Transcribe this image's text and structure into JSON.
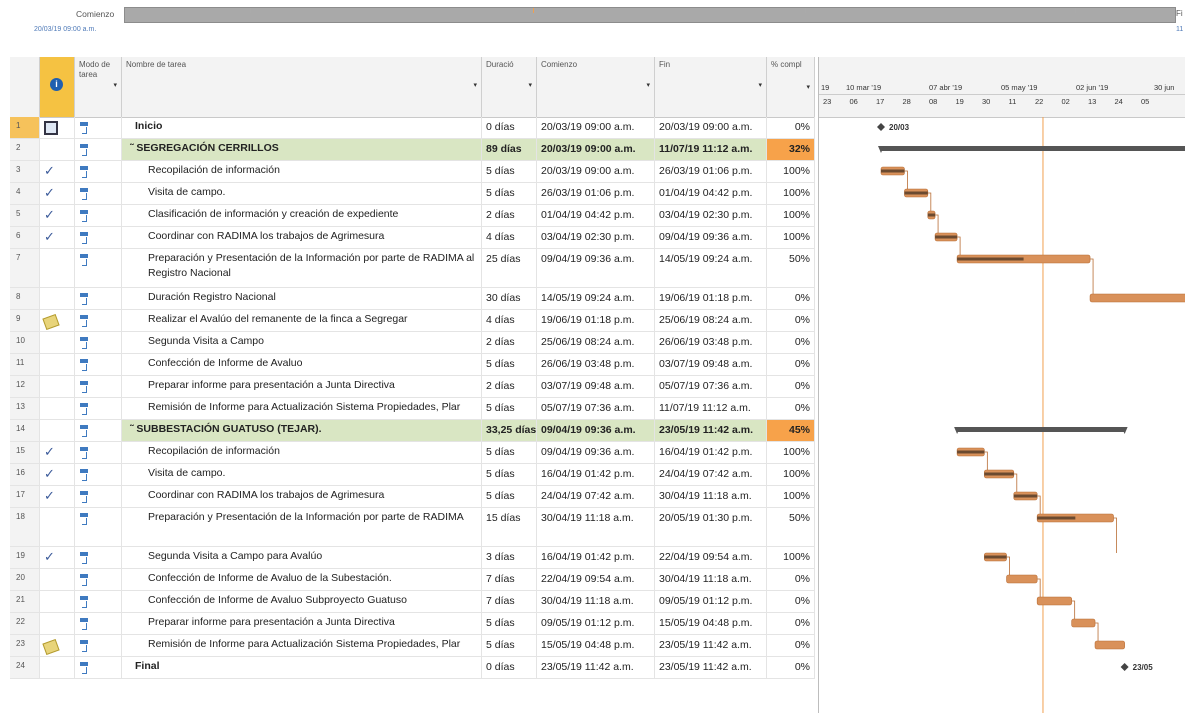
{
  "timeline": {
    "start_label": "Comienzo",
    "start_date": "20/03/19 09:00 a.m.",
    "end_label": "Fi",
    "end_date": "11"
  },
  "columns": {
    "mode": "Modo de tarea",
    "name": "Nombre de tarea",
    "duration": "Duració",
    "start": "Comienzo",
    "end": "Fin",
    "pct": "% compl"
  },
  "gantt_header": {
    "periods": [
      "19",
      "10 mar '19",
      "07 abr '19",
      "05 may '19",
      "02 jun '19",
      "30 jun"
    ],
    "days": [
      "23",
      "06",
      "17",
      "28",
      "08",
      "19",
      "30",
      "11",
      "22",
      "02",
      "13",
      "24",
      "05"
    ]
  },
  "tasks": [
    {
      "id": "1",
      "name": "Inicio",
      "duration": "0 días",
      "start": "20/03/19 09:00 a.m.",
      "end": "20/03/19 09:00 a.m.",
      "pct": "0%",
      "indicator": "",
      "kind": "milestone-bold"
    },
    {
      "id": "2",
      "name": "SEGREGACIÓN CERRILLOS",
      "duration": "89 días",
      "start": "20/03/19 09:00 a.m.",
      "end": "11/07/19 11:12 a.m.",
      "pct": "32%",
      "indicator": "",
      "kind": "summary"
    },
    {
      "id": "3",
      "name": "Recopilación de información",
      "duration": "5 días",
      "start": "20/03/19 09:00 a.m.",
      "end": "26/03/19 01:06 p.m.",
      "pct": "100%",
      "indicator": "check",
      "kind": "task"
    },
    {
      "id": "4",
      "name": "Visita de campo.",
      "duration": "5 días",
      "start": "26/03/19 01:06 p.m.",
      "end": "01/04/19 04:42 p.m.",
      "pct": "100%",
      "indicator": "check",
      "kind": "task"
    },
    {
      "id": "5",
      "name": "Clasificación de información y creación de expediente",
      "duration": "2 días",
      "start": "01/04/19 04:42 p.m.",
      "end": "03/04/19 02:30 p.m.",
      "pct": "100%",
      "indicator": "check",
      "kind": "task"
    },
    {
      "id": "6",
      "name": "Coordinar con RADIMA los trabajos de Agrimesura",
      "duration": "4 días",
      "start": "03/04/19 02:30 p.m.",
      "end": "09/04/19 09:36 a.m.",
      "pct": "100%",
      "indicator": "check",
      "kind": "task"
    },
    {
      "id": "7",
      "name": "Preparación y Presentación de la Información por parte de RADIMA al Registro Nacional",
      "duration": "25 días",
      "start": "09/04/19 09:36 a.m.",
      "end": "14/05/19 09:24 a.m.",
      "pct": "50%",
      "indicator": "",
      "kind": "task"
    },
    {
      "id": "8",
      "name": "Duración Registro Nacional",
      "duration": "30 días",
      "start": "14/05/19 09:24 a.m.",
      "end": "19/06/19 01:18 p.m.",
      "pct": "0%",
      "indicator": "",
      "kind": "task"
    },
    {
      "id": "9",
      "name": "Realizar el Avalúo del remanente de la finca a Segregar",
      "duration": "4 días",
      "start": "19/06/19 01:18 p.m.",
      "end": "25/06/19 08:24 a.m.",
      "pct": "0%",
      "indicator": "note",
      "kind": "task"
    },
    {
      "id": "10",
      "name": "Segunda Visita a Campo",
      "duration": "2 días",
      "start": "25/06/19 08:24 a.m.",
      "end": "26/06/19 03:48 p.m.",
      "pct": "0%",
      "indicator": "",
      "kind": "task"
    },
    {
      "id": "11",
      "name": "Confección de Informe de Avaluo",
      "duration": "5 días",
      "start": "26/06/19 03:48 p.m.",
      "end": "03/07/19 09:48 a.m.",
      "pct": "0%",
      "indicator": "",
      "kind": "task"
    },
    {
      "id": "12",
      "name": "Preparar informe para presentación a Junta Directiva",
      "duration": "2 días",
      "start": "03/07/19 09:48 a.m.",
      "end": "05/07/19 07:36 a.m.",
      "pct": "0%",
      "indicator": "",
      "kind": "task"
    },
    {
      "id": "13",
      "name": "Remisión de Informe para Actualización Sistema Propiedades, Plar",
      "duration": "5 días",
      "start": "05/07/19 07:36 a.m.",
      "end": "11/07/19 11:12 a.m.",
      "pct": "0%",
      "indicator": "",
      "kind": "task"
    },
    {
      "id": "14",
      "name": "SUBBESTACIÓN GUATUSO (TEJAR).",
      "duration": "33,25 días",
      "start": "09/04/19 09:36 a.m.",
      "end": "23/05/19 11:42 a.m.",
      "pct": "45%",
      "indicator": "",
      "kind": "summary"
    },
    {
      "id": "15",
      "name": "Recopilación de información",
      "duration": "5 días",
      "start": "09/04/19 09:36 a.m.",
      "end": "16/04/19 01:42 p.m.",
      "pct": "100%",
      "indicator": "check",
      "kind": "task"
    },
    {
      "id": "16",
      "name": "Visita de campo.",
      "duration": "5 días",
      "start": "16/04/19 01:42 p.m.",
      "end": "24/04/19 07:42 a.m.",
      "pct": "100%",
      "indicator": "check",
      "kind": "task"
    },
    {
      "id": "17",
      "name": "Coordinar con RADIMA los trabajos de Agrimesura",
      "duration": "5 días",
      "start": "24/04/19 07:42 a.m.",
      "end": "30/04/19 11:18 a.m.",
      "pct": "100%",
      "indicator": "check",
      "kind": "task"
    },
    {
      "id": "18",
      "name": "Preparación y Presentación de la Información por parte de RADIMA",
      "duration": "15 días",
      "start": "30/04/19 11:18 a.m.",
      "end": "20/05/19 01:30 p.m.",
      "pct": "50%",
      "indicator": "",
      "kind": "task"
    },
    {
      "id": "19",
      "name": "Segunda Visita a Campo para Avalúo",
      "duration": "3 días",
      "start": "16/04/19 01:42 p.m.",
      "end": "22/04/19 09:54 a.m.",
      "pct": "100%",
      "indicator": "check",
      "kind": "task"
    },
    {
      "id": "20",
      "name": "Confección de Informe de Avaluo de la Subestación.",
      "duration": "7 días",
      "start": "22/04/19 09:54 a.m.",
      "end": "30/04/19 11:18 a.m.",
      "pct": "0%",
      "indicator": "",
      "kind": "task"
    },
    {
      "id": "21",
      "name": "Confección de Informe de Avaluo Subproyecto Guatuso",
      "duration": "7 días",
      "start": "30/04/19 11:18 a.m.",
      "end": "09/05/19 01:12 p.m.",
      "pct": "0%",
      "indicator": "",
      "kind": "task"
    },
    {
      "id": "22",
      "name": "Preparar informe para presentación a Junta Directiva",
      "duration": "5 días",
      "start": "09/05/19 01:12 p.m.",
      "end": "15/05/19 04:48 p.m.",
      "pct": "0%",
      "indicator": "",
      "kind": "task"
    },
    {
      "id": "23",
      "name": "Remisión de Informe para Actualización Sistema Propiedades, Plar",
      "duration": "5 días",
      "start": "15/05/19 04:48 p.m.",
      "end": "23/05/19 11:42 a.m.",
      "pct": "0%",
      "indicator": "note",
      "kind": "task"
    },
    {
      "id": "24",
      "name": "Final",
      "duration": "0 días",
      "start": "23/05/19 11:42 a.m.",
      "end": "23/05/19 11:42 a.m.",
      "pct": "0%",
      "indicator": "",
      "kind": "milestone-bold"
    }
  ],
  "milestone_labels": {
    "start": "20/03",
    "end": "23/05"
  },
  "colors": {
    "summary_fill": "#d9e6c3",
    "pct_highlight": "#f7a24a",
    "bar": "#d9915a",
    "today_line": "#f0a050"
  }
}
